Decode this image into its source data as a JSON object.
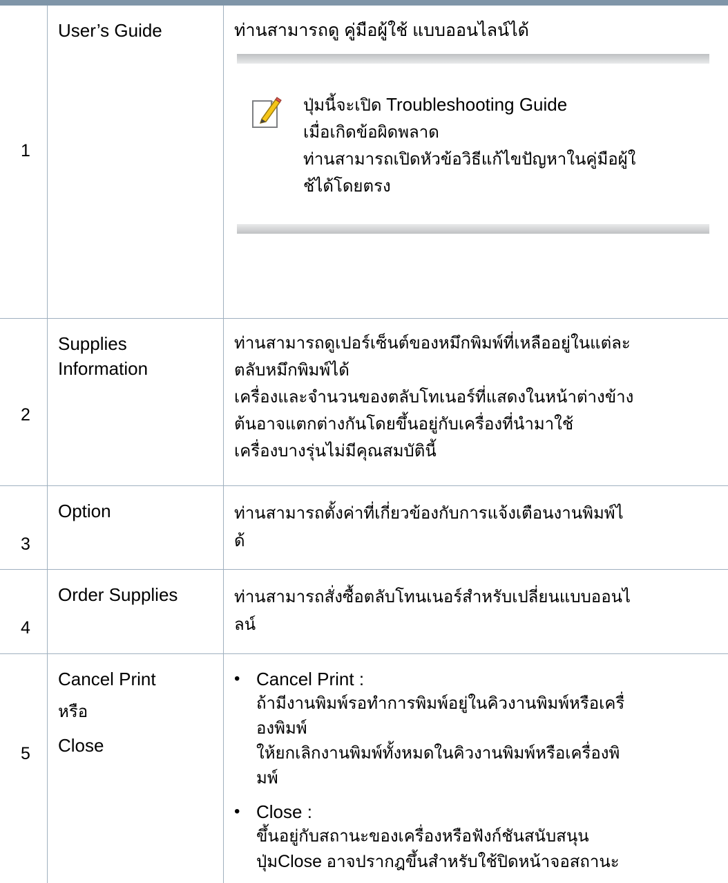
{
  "rows": [
    {
      "num": "1",
      "name": "User’s Guide",
      "desc": "ท่านสามารถดู คู่มือผู้ใช้ แบบออนไลน์ได้",
      "note": {
        "line1_prefix": "ปุ่มนี้จะเปิด",
        "line1_term": "Troubleshooting Guide",
        "line2": "เมื่อเกิดข้อผิดพลาด",
        "line3": "ท่านสามารถเปิดหัวข้อวิธีแก้ไขปัญหาในคู่มือผู้ใ",
        "line4": "ช้ได้โดยตรง"
      }
    },
    {
      "num": "2",
      "name_line1": "Supplies",
      "name_line2": "Information",
      "desc_lines": [
        "ท่านสามารถดูเปอร์เซ็นต์ของหมึกพิมพ์ที่เหลืออยู่ในแต่ละ",
        "ตลับหมึกพิมพ์ได้",
        "เครื่องและจำนวนของตลับโทเนอร์ที่แสดงในหน้าต่างข้าง",
        "ต้นอาจแตกต่างกันโดยขึ้นอยู่กับเครื่องที่นำมาใช้",
        "เครื่องบางรุ่นไม่มีคุณสมบัตินี้"
      ]
    },
    {
      "num": "3",
      "name": "Option",
      "desc_lines": [
        "ท่านสามารถตั้งค่าที่เกี่ยวข้องกับการแจ้งเตือนงานพิมพ์ไ",
        "ด้"
      ]
    },
    {
      "num": "4",
      "name": "Order Supplies",
      "desc_lines": [
        "ท่านสามารถสั่งซื้อตลับโทนเนอร์สำหรับเปลี่ยนแบบออนไ",
        "ลน์"
      ]
    },
    {
      "num": "5",
      "name_a": "Cancel Print",
      "name_or": "หรือ",
      "name_b": "Close",
      "bullets": [
        {
          "term": "Cancel Print :",
          "lines": [
            "ถ้ามีงานพิมพ์รอทำการพิมพ์อยู่ในคิวงานพิมพ์หรือเครื่",
            "องพิมพ์",
            "ให้ยกเลิกงานพิมพ์ทั้งหมดในคิวงานพิมพ์หรือเครื่องพิ",
            "มพ์"
          ]
        },
        {
          "term": "Close :",
          "lines": [
            "ขึ้นอยู่กับสถานะของเครื่องหรือฟังก์ชันสนับสนุน"
          ],
          "last_prefix": "ปุ่ม",
          "last_term": "Close",
          "last_suffix": " อาจปรากฎขึ้นสำหรับใช้ปิดหน้าจอสถานะ"
        }
      ]
    }
  ]
}
